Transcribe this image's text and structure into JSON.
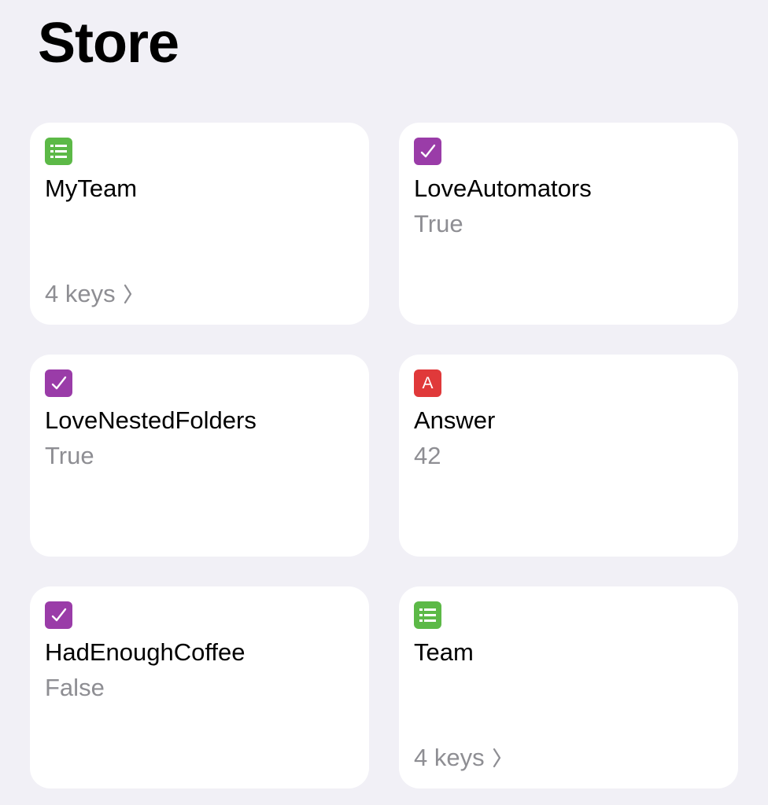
{
  "page": {
    "title": "Store"
  },
  "colors": {
    "background": "#f1f0f6",
    "dictionary_badge": "#5cb947",
    "boolean_badge": "#9a3ca8",
    "text_badge": "#e0393a",
    "secondary_text": "#8e8e93"
  },
  "items": [
    {
      "name": "MyTeam",
      "type_icon": "dictionary-icon",
      "footer": "4 keys"
    },
    {
      "name": "LoveAutomators",
      "type_icon": "boolean-check-icon",
      "value": "True"
    },
    {
      "name": "LoveNestedFolders",
      "type_icon": "boolean-check-icon",
      "value": "True"
    },
    {
      "name": "Answer",
      "type_icon": "text-icon",
      "icon_letter": "A",
      "value": "42"
    },
    {
      "name": "HadEnoughCoffee",
      "type_icon": "boolean-check-icon",
      "value": "False"
    },
    {
      "name": "Team",
      "type_icon": "dictionary-icon",
      "footer": "4 keys"
    }
  ]
}
